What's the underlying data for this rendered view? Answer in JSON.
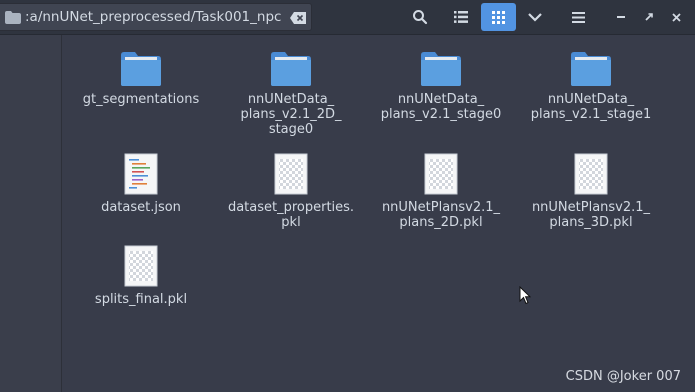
{
  "header": {
    "path": ":a/nnUNet_preprocessed/Task001_npc"
  },
  "icons": {
    "path_folder": "folder-icon",
    "clear": "clear-path-icon",
    "search": "search-icon",
    "list_view": "list-view-icon",
    "grid_view": "grid-view-icon",
    "options": "chevron-down-icon",
    "menu": "hamburger-menu-icon",
    "minimize": "minimize-icon",
    "maximize": "maximize-icon",
    "close": "close-icon"
  },
  "colors": {
    "accent": "#5294e2",
    "folder": "#5b9fe0",
    "background": "#383c4a",
    "headerbar": "#2f343f"
  },
  "files": [
    {
      "name": "gt_segmentations",
      "type": "folder"
    },
    {
      "name": "nnUNetData_\nplans_v2.1_2D_\nstage0",
      "type": "folder"
    },
    {
      "name": "nnUNetData_\nplans_v2.1_stage0",
      "type": "folder"
    },
    {
      "name": "nnUNetData_\nplans_v2.1_stage1",
      "type": "folder"
    },
    {
      "name": "dataset.json",
      "type": "json"
    },
    {
      "name": "dataset_properties.\npkl",
      "type": "pkl"
    },
    {
      "name": "nnUNetPlansv2.1_\nplans_2D.pkl",
      "type": "pkl"
    },
    {
      "name": "nnUNetPlansv2.1_\nplans_3D.pkl",
      "type": "pkl"
    },
    {
      "name": "splits_final.pkl",
      "type": "pkl"
    }
  ],
  "watermark": "CSDN @Joker 007"
}
